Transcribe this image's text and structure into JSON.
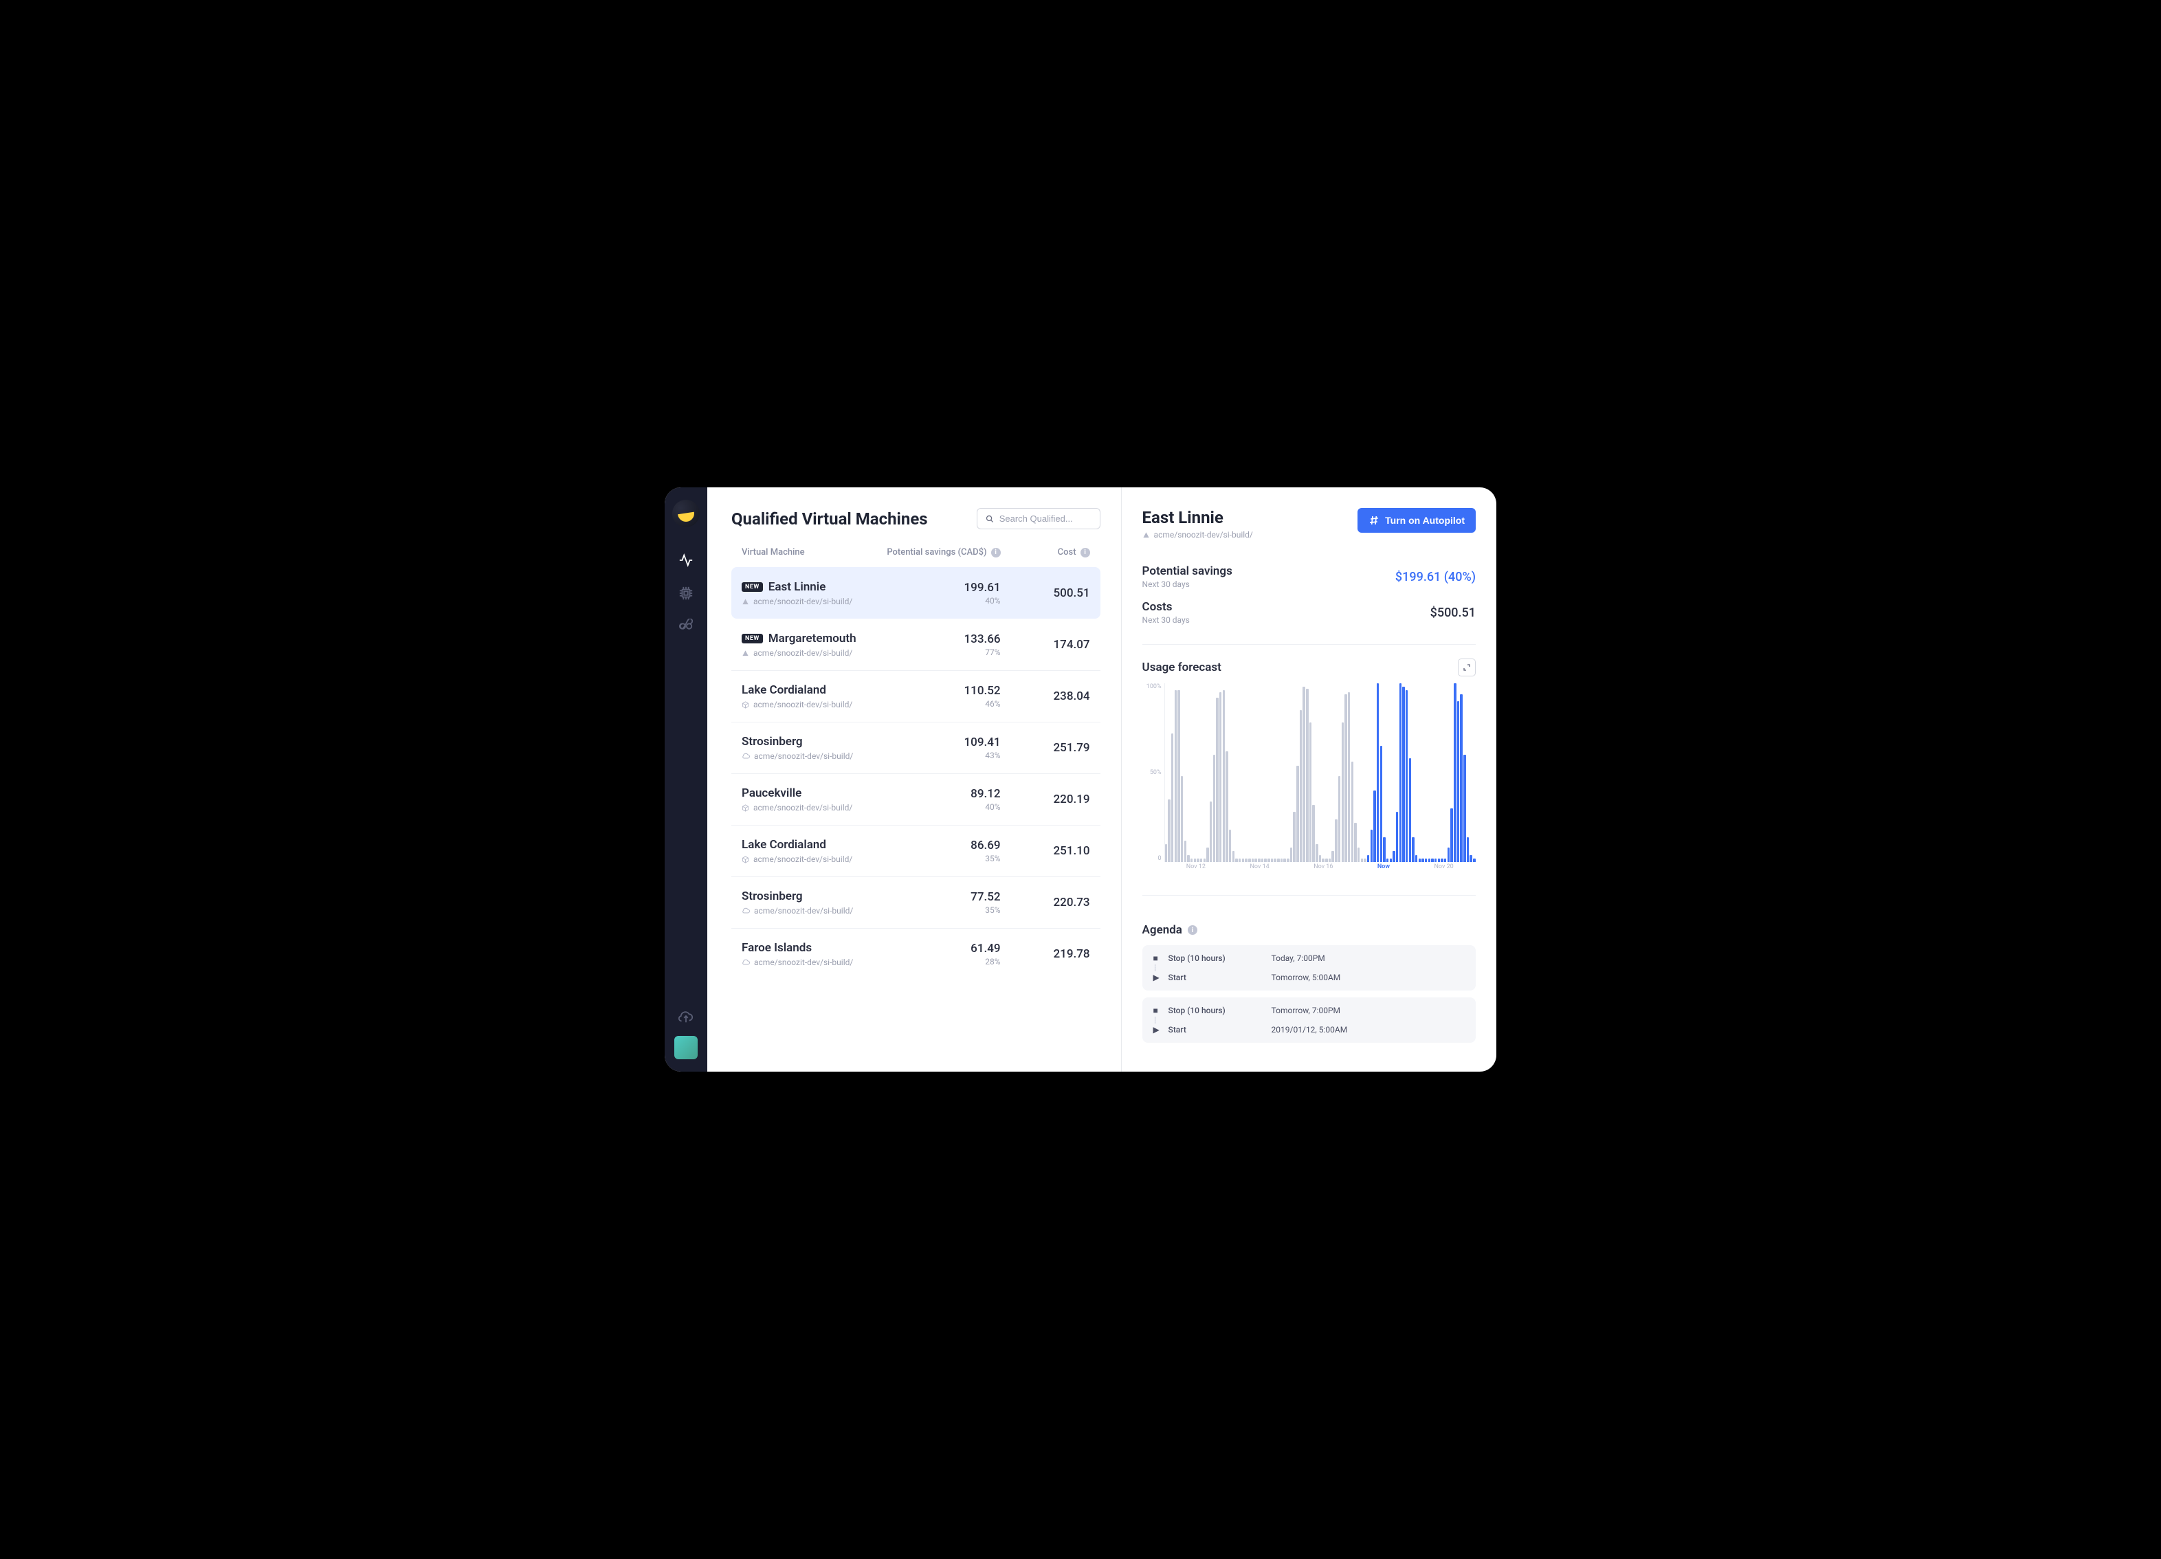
{
  "page": {
    "title": "Qualified Virtual Machines",
    "search_placeholder": "Search Qualified..."
  },
  "columns": {
    "vm": "Virtual Machine",
    "savings": "Potential savings (CAD$)",
    "cost": "Cost"
  },
  "rows": [
    {
      "new": true,
      "icon": "tri",
      "name": "East Linnie",
      "path": "acme/snoozit-dev/si-build/",
      "savings": "199.61",
      "pct": "40%",
      "cost": "500.51",
      "selected": true
    },
    {
      "new": true,
      "icon": "tri",
      "name": "Margaretemouth",
      "path": "acme/snoozit-dev/si-build/",
      "savings": "133.66",
      "pct": "77%",
      "cost": "174.07"
    },
    {
      "new": false,
      "icon": "box",
      "name": "Lake Cordialand",
      "path": "acme/snoozit-dev/si-build/",
      "savings": "110.52",
      "pct": "46%",
      "cost": "238.04"
    },
    {
      "new": false,
      "icon": "cloud",
      "name": "Strosinberg",
      "path": "acme/snoozit-dev/si-build/",
      "savings": "109.41",
      "pct": "43%",
      "cost": "251.79"
    },
    {
      "new": false,
      "icon": "box",
      "name": "Paucekville",
      "path": "acme/snoozit-dev/si-build/",
      "savings": "89.12",
      "pct": "40%",
      "cost": "220.19"
    },
    {
      "new": false,
      "icon": "box",
      "name": "Lake Cordialand",
      "path": "acme/snoozit-dev/si-build/",
      "savings": "86.69",
      "pct": "35%",
      "cost": "251.10"
    },
    {
      "new": false,
      "icon": "cloud",
      "name": "Strosinberg",
      "path": "acme/snoozit-dev/si-build/",
      "savings": "77.52",
      "pct": "35%",
      "cost": "220.73"
    },
    {
      "new": false,
      "icon": "cloud",
      "name": "Faroe Islands",
      "path": "acme/snoozit-dev/si-build/",
      "savings": "61.49",
      "pct": "28%",
      "cost": "219.78"
    }
  ],
  "detail": {
    "title": "East Linnie",
    "path": "acme/snoozit-dev/si-build/",
    "autopilot_label": "Turn on Autopilot",
    "savings_label": "Potential savings",
    "savings_sub": "Next 30 days",
    "savings_value": "$199.61 (40%)",
    "costs_label": "Costs",
    "costs_sub": "Next 30 days",
    "costs_value": "$500.51",
    "usage_title": "Usage forecast",
    "agenda_title": "Agenda",
    "new_badge": "NEW"
  },
  "agenda": [
    {
      "stop_label": "Stop (10 hours)",
      "stop_time": "Today, 7:00PM",
      "start_label": "Start",
      "start_time": "Tomorrow, 5:00AM"
    },
    {
      "stop_label": "Stop (10 hours)",
      "stop_time": "Tomorrow, 7:00PM",
      "start_label": "Start",
      "start_time": "2019/01/12, 5:00AM"
    }
  ],
  "chart_data": {
    "type": "bar",
    "ylabel": "",
    "ylim": [
      0,
      100
    ],
    "yticks": [
      "100%",
      "50%",
      "0"
    ],
    "xticks": [
      "Nov 12",
      "Nov 14",
      "Nov 16",
      "Now",
      "Nov 20"
    ],
    "series": [
      {
        "name": "historical",
        "color": "#c8cdda"
      },
      {
        "name": "forecast",
        "color": "#3a6ff7"
      }
    ],
    "values": [
      10,
      35,
      72,
      96,
      96,
      48,
      12,
      4,
      2,
      2,
      2,
      2,
      2,
      8,
      34,
      60,
      92,
      95,
      96,
      62,
      18,
      6,
      2,
      2,
      2,
      2,
      2,
      2,
      2,
      2,
      2,
      2,
      2,
      2,
      2,
      2,
      2,
      2,
      2,
      8,
      28,
      54,
      85,
      98,
      97,
      78,
      32,
      10,
      4,
      2,
      2,
      2,
      6,
      24,
      48,
      78,
      94,
      95,
      56,
      22,
      8,
      2,
      2,
      4,
      18,
      40,
      100,
      65,
      14,
      2,
      2,
      6,
      28,
      100,
      98,
      96,
      58,
      14,
      4,
      2,
      2,
      2,
      2,
      2,
      2,
      2,
      2,
      2,
      8,
      30,
      100,
      90,
      94,
      60,
      14,
      4,
      2
    ],
    "future_start_index": 63
  }
}
